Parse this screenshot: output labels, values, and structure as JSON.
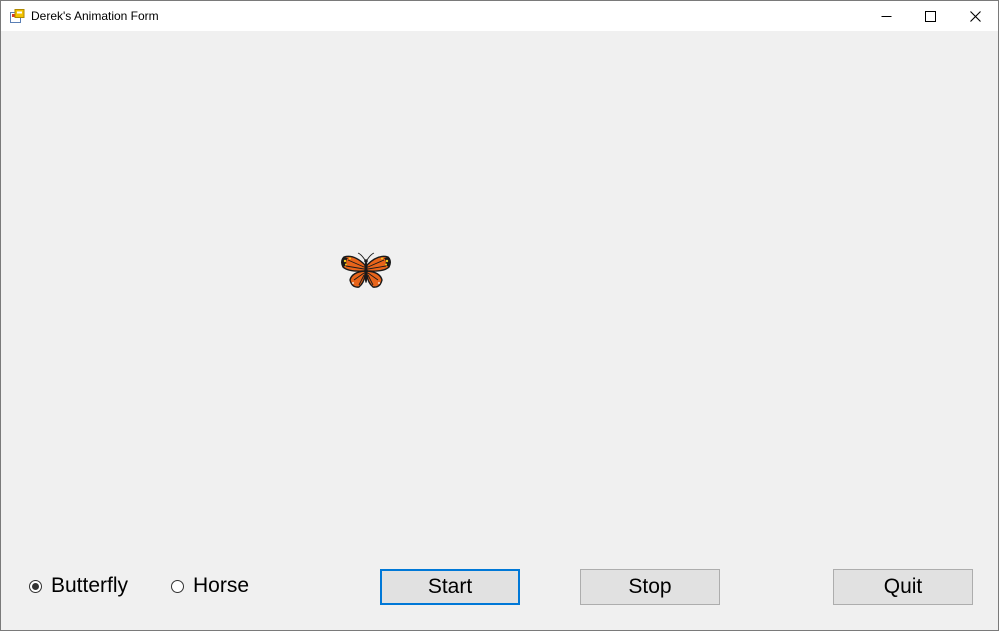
{
  "window": {
    "title": "Derek's Animation Form",
    "icon": "form-app-icon"
  },
  "caption_buttons": {
    "minimize_icon": "minimize-icon",
    "maximize_icon": "maximize-icon",
    "close_icon": "close-icon"
  },
  "canvas": {
    "sprite": "butterfly-sprite",
    "sprite_colors": {
      "wing": "#e8641a",
      "outline": "#1a1a1a",
      "spots": "#f5d020"
    }
  },
  "options": {
    "butterfly_label": "Butterfly",
    "horse_label": "Horse",
    "selected": "Butterfly"
  },
  "buttons": {
    "start_label": "Start",
    "stop_label": "Stop",
    "quit_label": "Quit"
  },
  "colors": {
    "focus_border": "#0078d7",
    "client_bg": "#f0f0f0",
    "button_bg": "#e1e1e1"
  }
}
